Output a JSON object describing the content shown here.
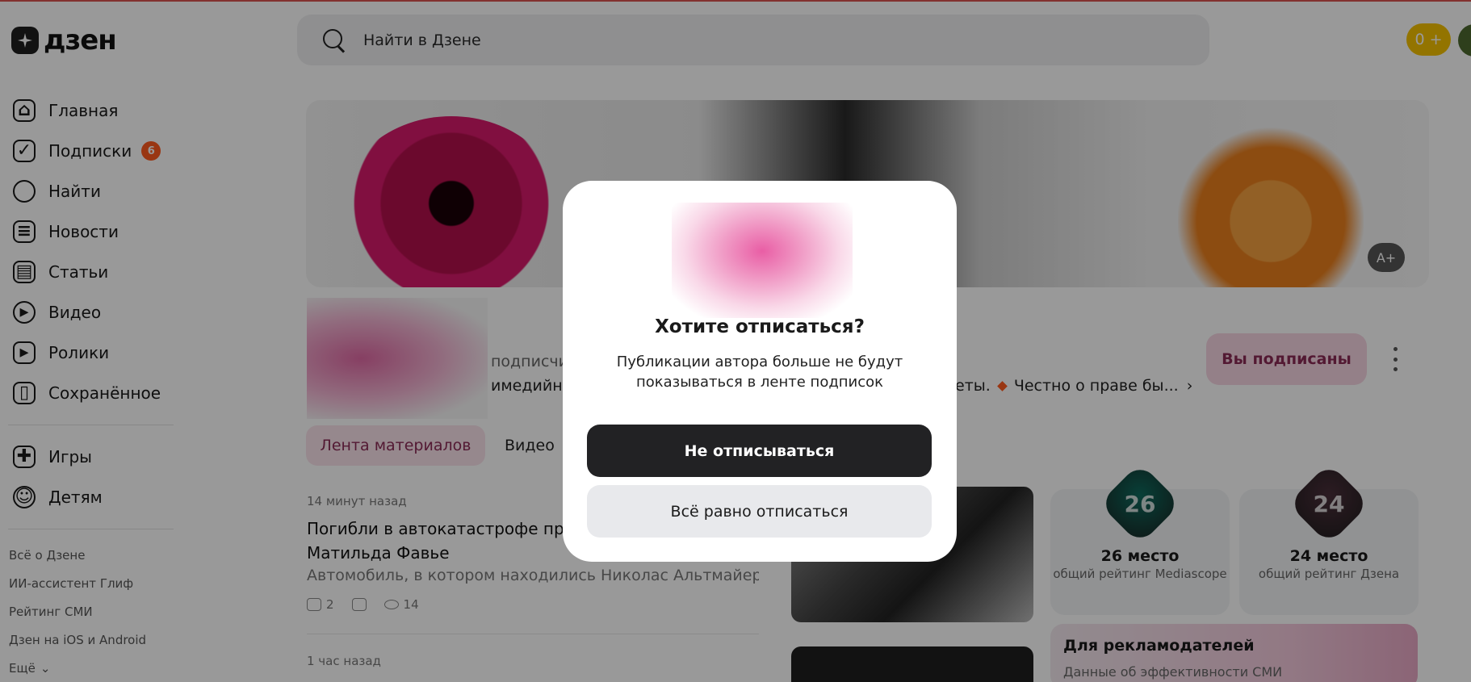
{
  "header": {
    "logo_text": "дзен",
    "search_placeholder": "Найти в Дзене",
    "coins_value": "0 +"
  },
  "sidebar": {
    "items": [
      {
        "label": "Главная",
        "icon": "home-icon"
      },
      {
        "label": "Подписки",
        "icon": "subscriptions-icon",
        "badge": "6"
      },
      {
        "label": "Найти",
        "icon": "search-icon"
      },
      {
        "label": "Новости",
        "icon": "news-icon"
      },
      {
        "label": "Статьи",
        "icon": "articles-icon"
      },
      {
        "label": "Видео",
        "icon": "video-icon"
      },
      {
        "label": "Ролики",
        "icon": "shorts-icon"
      },
      {
        "label": "Сохранённое",
        "icon": "bookmark-icon"
      }
    ],
    "extra_items": [
      {
        "label": "Игры",
        "icon": "gamepad-icon"
      },
      {
        "label": "Детям",
        "icon": "kids-icon"
      }
    ],
    "footer_links": [
      "Всё о Дзене",
      "ИИ-ассистент Глиф",
      "Рейтинг СМИ",
      "Дзен на iOS и Android",
      "Ещё"
    ]
  },
  "channel": {
    "subscribers_fragment": "подписчи",
    "description_fragment": "имедийна",
    "description_tail": "еты.",
    "link_text": "Честно о праве бы...",
    "subscribed_label": "Вы подписаны",
    "banner_badge": "A+"
  },
  "tabs": {
    "feed": "Лента материалов",
    "video": "Видео"
  },
  "post": {
    "time": "14 минут назад",
    "title": "Погибли в автокатастрофе продю PR-директор Матильда Фавье",
    "excerpt": "Автомобиль, в котором находились Николас Альтмайер и...",
    "likes": "2",
    "views": "14"
  },
  "post2": {
    "time": "1 час назад"
  },
  "ratings": [
    {
      "number": "26",
      "title": "26 место",
      "subtitle": "общий рейтинг Mediascope",
      "color": "#0e6b5e"
    },
    {
      "number": "24",
      "title": "24 место",
      "subtitle": "общий рейтинг Дзена",
      "color": "#4a2f3a"
    }
  ],
  "advertisers": {
    "title": "Для рекламодателей",
    "subtitle": "Данные об эффективности СМИ"
  },
  "modal": {
    "title": "Хотите отписаться?",
    "text": "Публикации автора больше не будут показываться в ленте подписок",
    "stay_button": "Не отписываться",
    "unsubscribe_button": "Всё равно отписаться"
  }
}
